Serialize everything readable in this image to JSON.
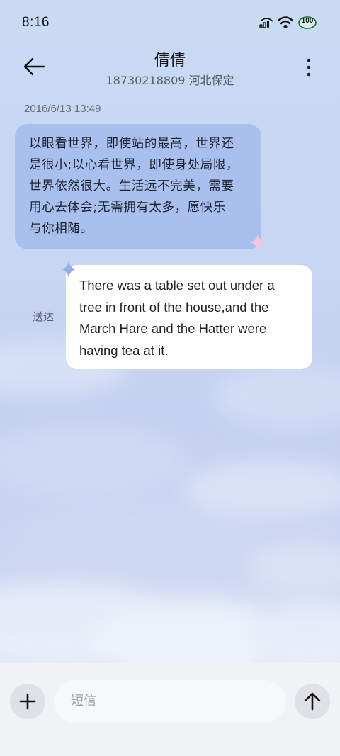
{
  "status_bar": {
    "time": "8:16",
    "battery": "100",
    "icons": [
      "signal-icon",
      "wifi-icon",
      "battery-icon"
    ]
  },
  "header": {
    "contact_name": "倩倩",
    "contact_info": "18730218809 河北保定",
    "icons": [
      "back-arrow-icon",
      "more-vertical-icon"
    ]
  },
  "conversation": {
    "timestamp": "2016/6/13 13:49",
    "messages": [
      {
        "direction": "incoming",
        "lines": [
          "以眼看世界，即使站的最高，世界还",
          "是很小;以心看世界，即使身处局限，",
          "世界依然很大。生活远不完美，需要",
          "用心去体会;无需拥有太多，愿快乐",
          "与你相随。"
        ]
      },
      {
        "direction": "outgoing",
        "status": "送达",
        "lines": [
          "There was a table set out under a",
          "tree in front of the house,and the",
          "March Hare and the Hatter were",
          "having tea at it."
        ]
      }
    ]
  },
  "composer": {
    "placeholder": "短信",
    "icons": [
      "plus-icon",
      "send-arrow-icon"
    ]
  },
  "colors": {
    "incoming_bubble": "#a9c0ee",
    "outgoing_bubble": "#ffffff",
    "bottom_bar": "#f1f2f5"
  }
}
